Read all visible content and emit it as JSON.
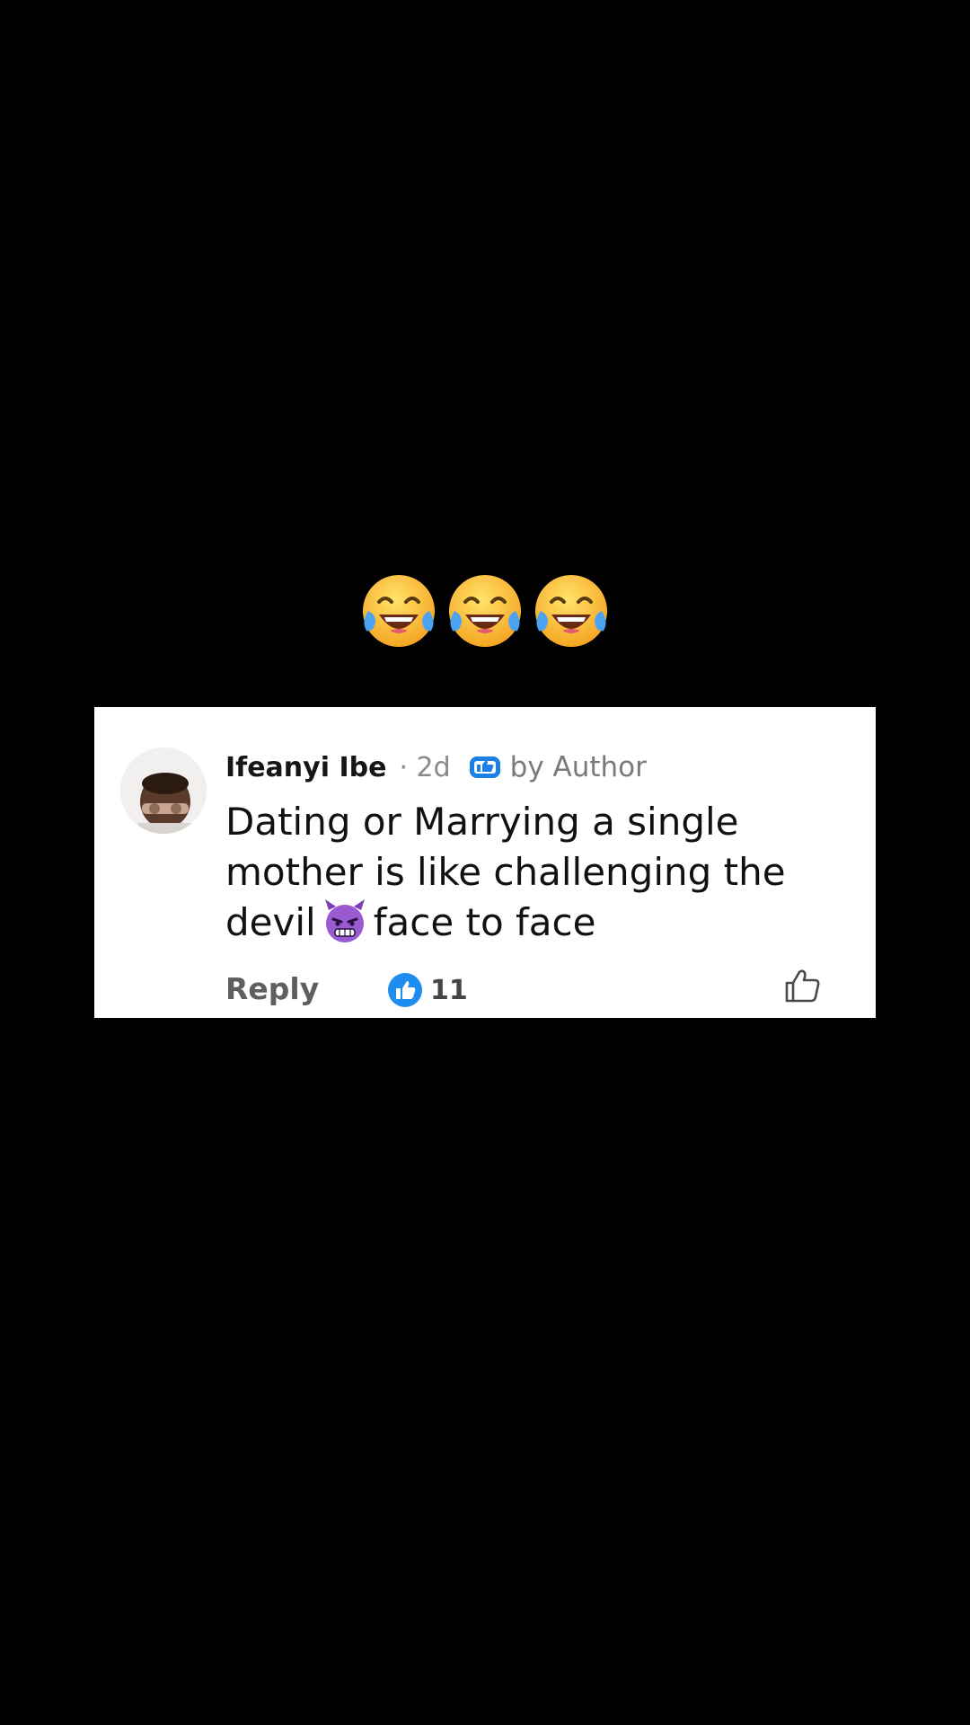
{
  "header_emojis": [
    "face-with-tears-of-joy-icon",
    "face-with-tears-of-joy-icon",
    "face-with-tears-of-joy-icon"
  ],
  "comment": {
    "author_name": "Ifeanyi Ibe",
    "time": "· 2d",
    "badge_label": "by Author",
    "text_before_emoji": "Dating or Marrying a single mother is like challenging the devil",
    "inline_emoji": "angry-devil-icon",
    "text_after_emoji": "face to face",
    "reply_label": "Reply",
    "reaction_count": "11"
  },
  "colors": {
    "background": "#000000",
    "card": "#ffffff",
    "reaction_blue": "#1f8cf0",
    "badge_blue": "#1a80e5",
    "devil_purple": "#7b3fb3"
  }
}
